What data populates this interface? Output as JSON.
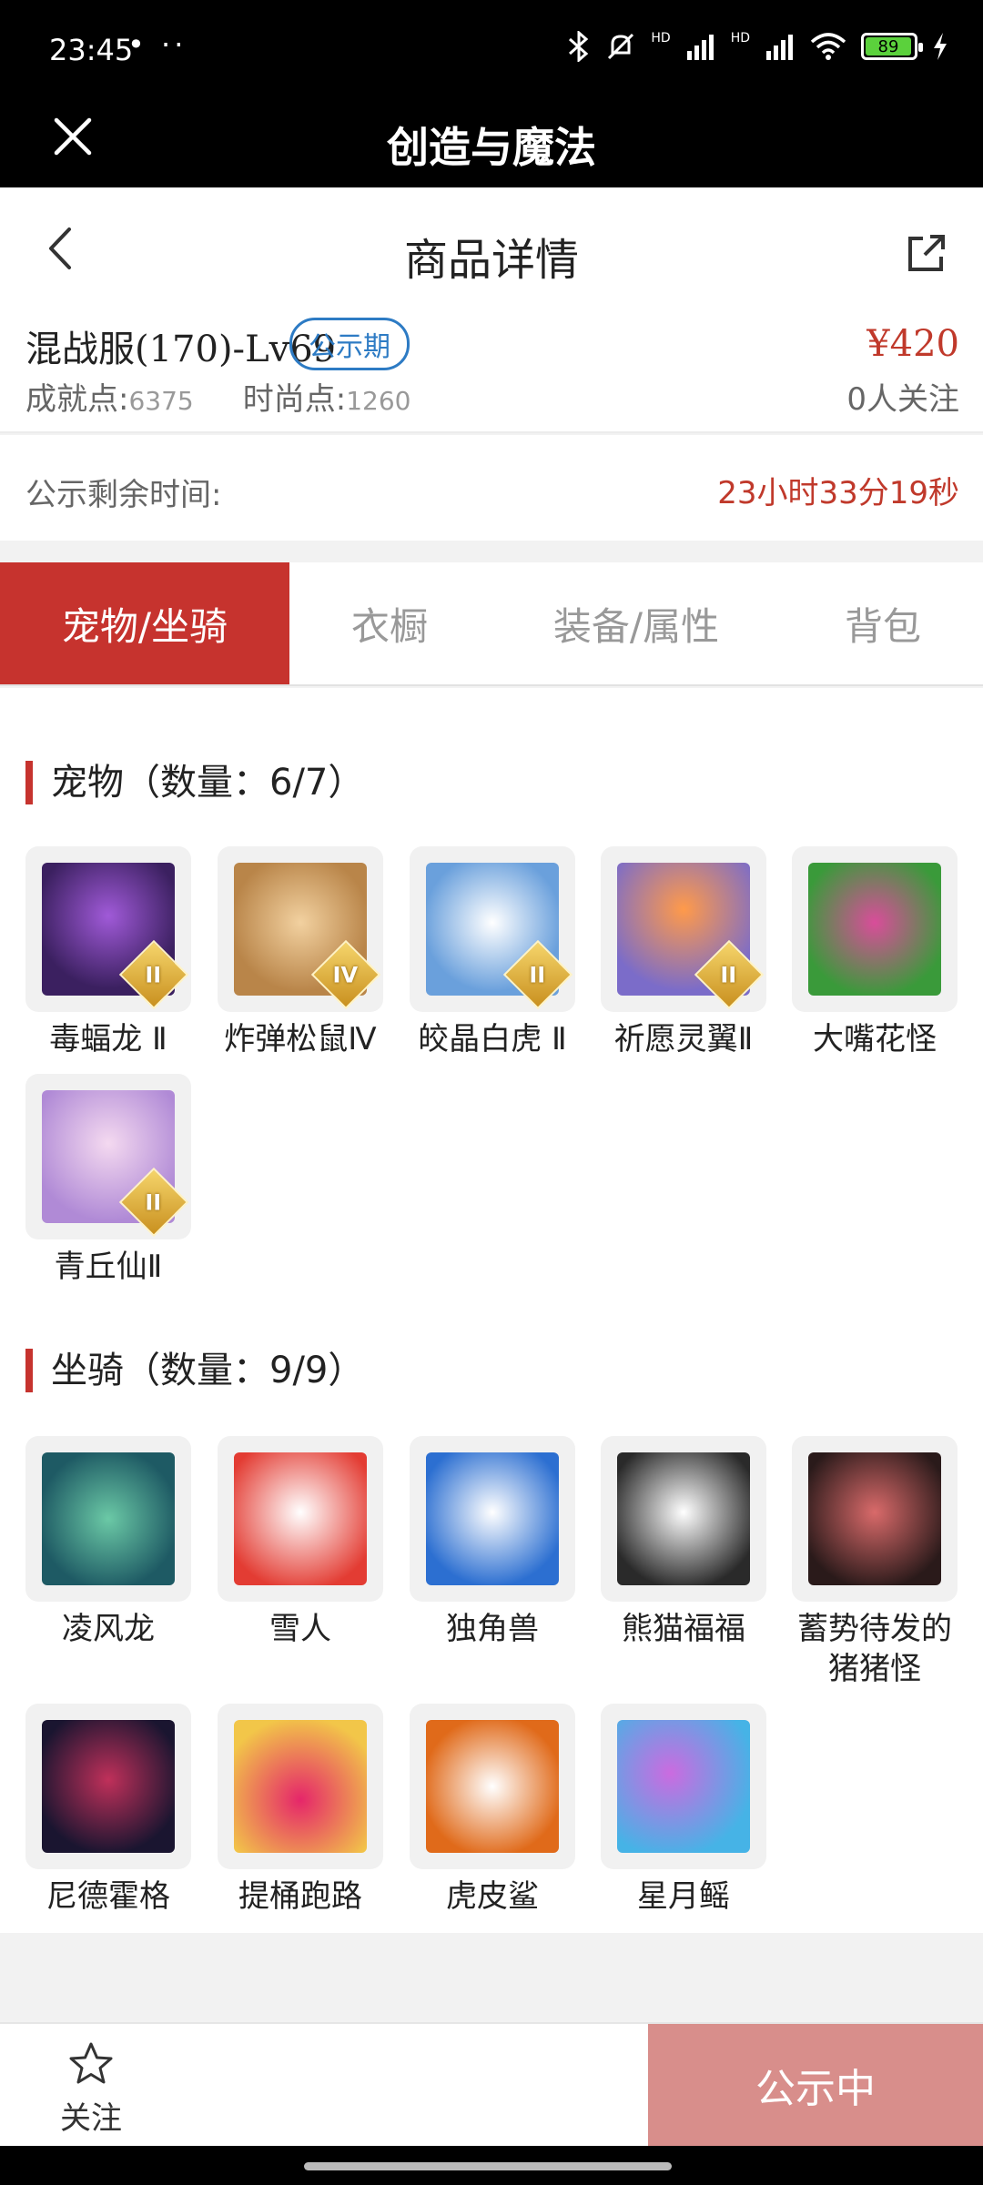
{
  "status_bar": {
    "time": "23:45",
    "dots": "• ··",
    "icons": [
      "bluetooth-icon",
      "mute-icon",
      "signal-icon",
      "signal-icon",
      "wifi-icon",
      "battery-icon",
      "charging-icon"
    ],
    "hd1": "HD",
    "hd2": "HD",
    "battery": "89"
  },
  "app_header": {
    "title": "创造与魔法"
  },
  "page_header": {
    "title": "商品详情"
  },
  "product": {
    "server": "混战服(170)-Lv69",
    "badge": "公示期",
    "price": "¥420",
    "achievement_label": "成就点:",
    "achievement_value": "6375",
    "fashion_label": "时尚点:",
    "fashion_value": "1260",
    "followers": "0人关注"
  },
  "countdown": {
    "label": "公示剩余时间:",
    "value": "23小时33分19秒"
  },
  "tabs": [
    {
      "label": "宠物/坐骑",
      "active": true
    },
    {
      "label": "衣橱",
      "active": false
    },
    {
      "label": "装备/属性",
      "active": false
    },
    {
      "label": "背包",
      "active": false
    }
  ],
  "pets": {
    "title": "宠物（数量：6/7）",
    "items": [
      {
        "name": "毒蝠龙 Ⅱ",
        "tier": "II"
      },
      {
        "name": "炸弹松鼠Ⅳ",
        "tier": "IV"
      },
      {
        "name": "皎晶白虎 Ⅱ",
        "tier": "II"
      },
      {
        "name": "祈愿灵翼Ⅱ",
        "tier": "II"
      },
      {
        "name": "大嘴花怪",
        "tier": ""
      },
      {
        "name": "青丘仙Ⅱ",
        "tier": "II"
      }
    ]
  },
  "mounts": {
    "title": "坐骑（数量：9/9）",
    "items": [
      {
        "name": "凌风龙"
      },
      {
        "name": "雪人"
      },
      {
        "name": "独角兽"
      },
      {
        "name": "熊猫福福"
      },
      {
        "name": "蓄势待发的猪猪怪"
      },
      {
        "name": "尼德霍格"
      },
      {
        "name": "提桶跑路"
      },
      {
        "name": "虎皮鲨"
      },
      {
        "name": "星月鳐"
      }
    ]
  },
  "bottom_bar": {
    "follow_label": "关注",
    "status_label": "公示中"
  },
  "colors": {
    "accent": "#c6332e",
    "price": "#c0392b",
    "badge": "#2d7bc4",
    "status_button": "#d88e8b"
  }
}
